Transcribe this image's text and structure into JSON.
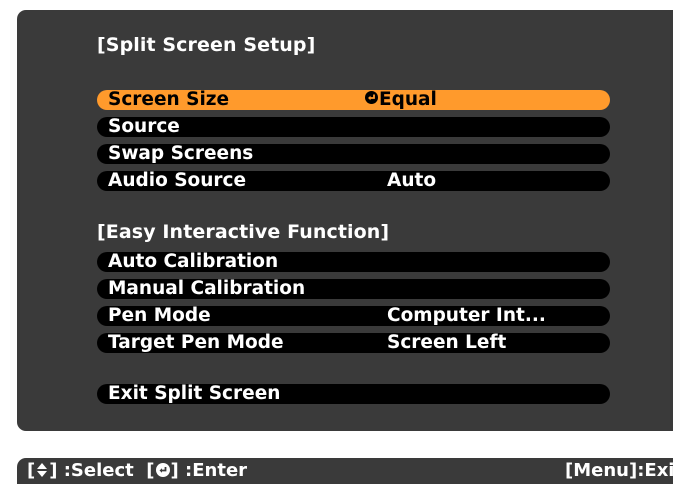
{
  "sections": [
    {
      "header": "[Split Screen Setup]",
      "items": [
        {
          "label": "Screen Size",
          "value": "Equal",
          "selected": true
        },
        {
          "label": "Source",
          "value": ""
        },
        {
          "label": "Swap Screens",
          "value": ""
        },
        {
          "label": "Audio Source",
          "value": "Auto"
        }
      ]
    },
    {
      "header": "[Easy Interactive Function]",
      "items": [
        {
          "label": "Auto Calibration",
          "value": ""
        },
        {
          "label": "Manual Calibration",
          "value": ""
        },
        {
          "label": "Pen Mode",
          "value": "Computer Int..."
        },
        {
          "label": "Target Pen Mode",
          "value": "Screen Left"
        }
      ]
    }
  ],
  "exit_item": {
    "label": "Exit Split Screen"
  },
  "footer": {
    "select_open": "[",
    "select_close": "] :Select",
    "enter_open": "[",
    "enter_close": "] :Enter",
    "menu_exit": "[Menu]:Exit"
  },
  "colors": {
    "panel": "#3a3a3a",
    "item": "#000000",
    "selected": "#ff9a2c"
  },
  "icons": {
    "enter": "enter-icon",
    "select": "up-down-arrow-icon"
  }
}
